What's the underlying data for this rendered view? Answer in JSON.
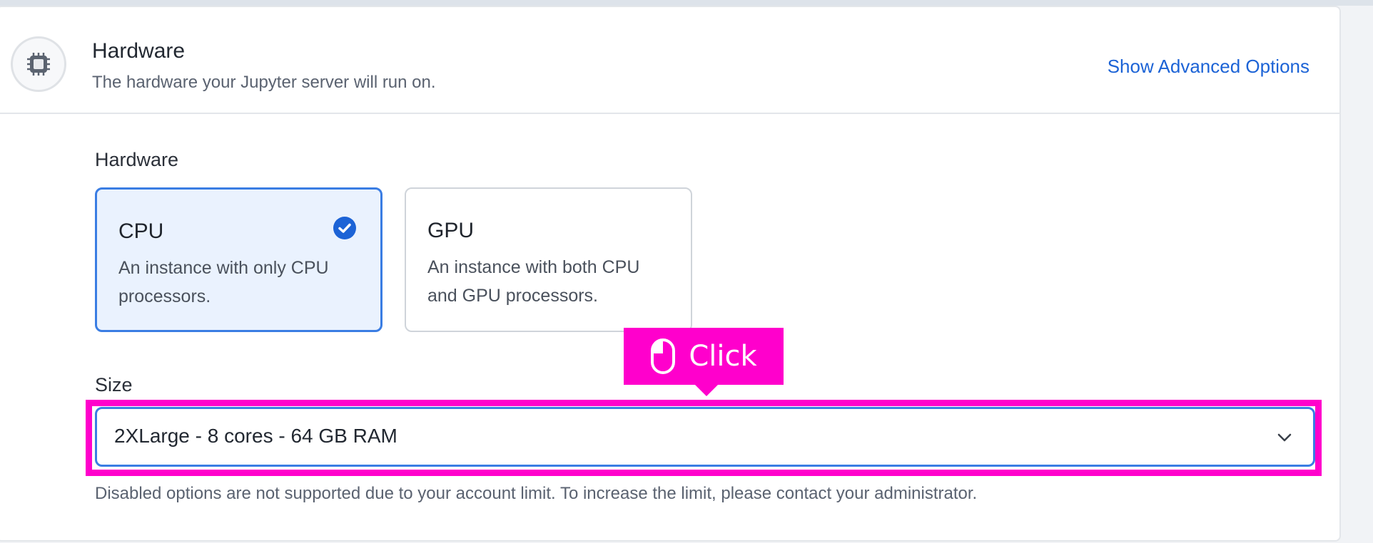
{
  "header": {
    "title": "Hardware",
    "subtitle": "The hardware your Jupyter server will run on.",
    "advanced_link": "Show Advanced Options",
    "icon": "chip-icon"
  },
  "hardware": {
    "label": "Hardware",
    "options": [
      {
        "title": "CPU",
        "description": "An instance with only CPU processors.",
        "selected": true
      },
      {
        "title": "GPU",
        "description": "An instance with both CPU and GPU processors.",
        "selected": false
      }
    ]
  },
  "size": {
    "label": "Size",
    "selected_value": "2XLarge - 8 cores - 64 GB RAM",
    "helper": "Disabled options are not supported due to your account limit. To increase the limit, please contact your administrator."
  },
  "annotation": {
    "label": "Click",
    "icon": "mouse-icon",
    "color": "#ff00cc"
  },
  "colors": {
    "accent": "#3a7de3",
    "link": "#1c63d6",
    "selected_bg": "#eaf2fe"
  }
}
